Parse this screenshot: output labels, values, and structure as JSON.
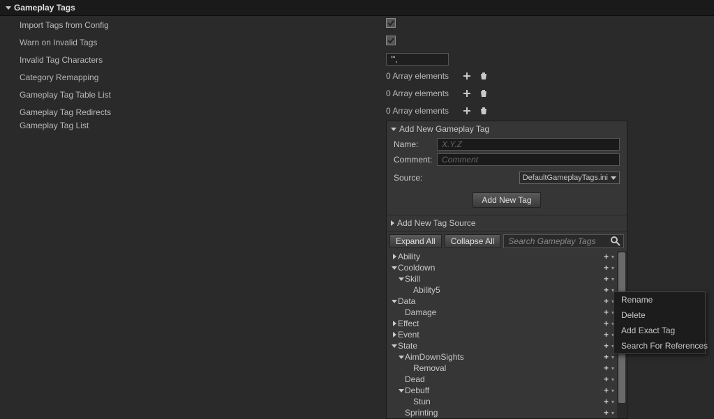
{
  "section_title": "Gameplay Tags",
  "props": {
    "import_tags": {
      "label": "Import Tags from Config",
      "checked": true
    },
    "warn_invalid": {
      "label": "Warn on Invalid Tags",
      "checked": true
    },
    "invalid_chars": {
      "label": "Invalid Tag Characters",
      "value": "\"',"
    },
    "category_remap": {
      "label": "Category Remapping",
      "array_text": "0 Array elements"
    },
    "tag_table_list": {
      "label": "Gameplay Tag Table List",
      "array_text": "0 Array elements"
    },
    "tag_redirects": {
      "label": "Gameplay Tag Redirects",
      "array_text": "0 Array elements"
    },
    "tag_list": {
      "label": "Gameplay Tag List"
    }
  },
  "add_panel": {
    "header": "Add New Gameplay Tag",
    "name_label": "Name:",
    "name_placeholder": "X.Y.Z",
    "comment_label": "Comment:",
    "comment_placeholder": "Comment",
    "source_label": "Source:",
    "source_value": "DefaultGameplayTags.ini",
    "add_button": "Add New Tag",
    "new_source_header": "Add New Tag Source"
  },
  "toolbar": {
    "expand_all": "Expand All",
    "collapse_all": "Collapse All",
    "search_placeholder": "Search Gameplay Tags"
  },
  "tree": [
    {
      "label": "Ability",
      "indent": 0,
      "arrow": "right"
    },
    {
      "label": "Cooldown",
      "indent": 0,
      "arrow": "down"
    },
    {
      "label": "Skill",
      "indent": 1,
      "arrow": "down"
    },
    {
      "label": "Ability5",
      "indent": 2,
      "arrow": "none"
    },
    {
      "label": "Data",
      "indent": 0,
      "arrow": "down"
    },
    {
      "label": "Damage",
      "indent": 1,
      "arrow": "none"
    },
    {
      "label": "Effect",
      "indent": 0,
      "arrow": "right"
    },
    {
      "label": "Event",
      "indent": 0,
      "arrow": "right"
    },
    {
      "label": "State",
      "indent": 0,
      "arrow": "down"
    },
    {
      "label": "AimDownSights",
      "indent": 1,
      "arrow": "down"
    },
    {
      "label": "Removal",
      "indent": 2,
      "arrow": "none"
    },
    {
      "label": "Dead",
      "indent": 1,
      "arrow": "none"
    },
    {
      "label": "Debuff",
      "indent": 1,
      "arrow": "down"
    },
    {
      "label": "Stun",
      "indent": 2,
      "arrow": "none"
    },
    {
      "label": "Sprinting",
      "indent": 1,
      "arrow": "none"
    }
  ],
  "context_menu": {
    "items": [
      "Rename",
      "Delete",
      "Add Exact Tag",
      "Search For References"
    ]
  }
}
